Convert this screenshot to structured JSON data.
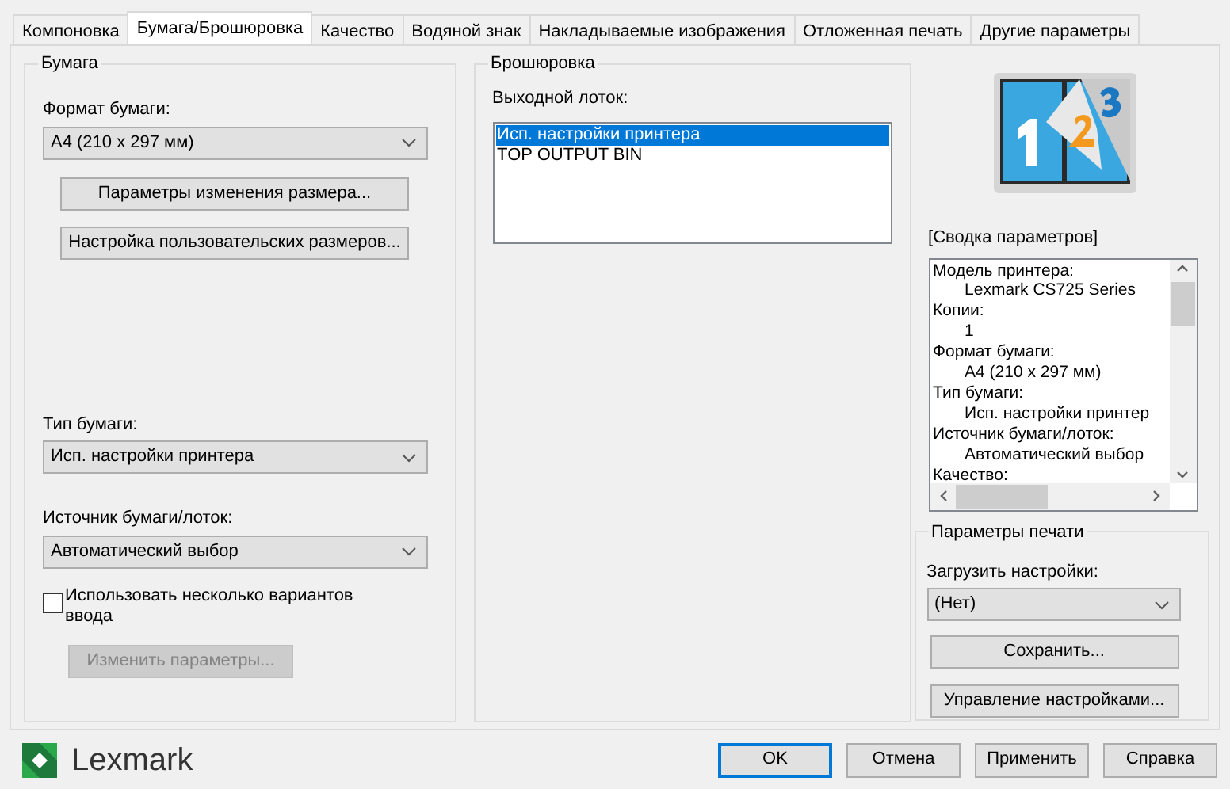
{
  "tabs": [
    {
      "label": "Компоновка",
      "selected": false
    },
    {
      "label": "Бумага/Брошюровка",
      "selected": true
    },
    {
      "label": "Качество",
      "selected": false
    },
    {
      "label": "Водяной знак",
      "selected": false
    },
    {
      "label": "Накладываемые изображения",
      "selected": false
    },
    {
      "label": "Отложенная печать",
      "selected": false
    },
    {
      "label": "Другие параметры",
      "selected": false
    }
  ],
  "paper": {
    "title": "Бумага",
    "size_label": "Формат бумаги:",
    "size_value": "A4 (210 x 297 мм)",
    "resize_button": "Параметры изменения размера...",
    "custom_button": "Настройка пользовательских размеров...",
    "type_label": "Тип бумаги:",
    "type_value": "Исп. настройки принтера",
    "source_label": "Источник бумаги/лоток:",
    "source_value": "Автоматический выбор",
    "multi_input": {
      "label": "Использовать несколько вариантов ввода",
      "checked": false
    },
    "change_button": {
      "label": "Изменить параметры...",
      "disabled": true
    }
  },
  "finishing": {
    "title": "Брошюровка",
    "output_label": "Выходной лоток:",
    "output_items": [
      {
        "label": "Исп. настройки принтера",
        "selected": true
      },
      {
        "label": "TOP OUTPUT BIN",
        "selected": false
      }
    ]
  },
  "summary": {
    "title": "[Сводка параметров]",
    "lines": [
      {
        "kind": "label",
        "text": "Модель принтера:"
      },
      {
        "kind": "value",
        "text": "Lexmark CS725 Series"
      },
      {
        "kind": "label",
        "text": "Копии:"
      },
      {
        "kind": "value",
        "text": "1"
      },
      {
        "kind": "label",
        "text": "Формат бумаги:"
      },
      {
        "kind": "value",
        "text": "A4 (210 x 297 мм)"
      },
      {
        "kind": "label",
        "text": "Тип бумаги:"
      },
      {
        "kind": "value",
        "text": "Исп. настройки принтер"
      },
      {
        "kind": "label",
        "text": "Источник бумаги/лоток:"
      },
      {
        "kind": "value",
        "text": "Автоматический выбор"
      },
      {
        "kind": "label",
        "text": "Качество:"
      }
    ]
  },
  "print_settings": {
    "title": "Параметры печати",
    "load_label": "Загрузить настройки:",
    "load_value": "(Нет)",
    "save_button": "Сохранить...",
    "manage_button": "Управление настройками..."
  },
  "brand": "Lexmark",
  "buttons": [
    {
      "label": "OK",
      "default": true
    },
    {
      "label": "Отмена",
      "default": false
    },
    {
      "label": "Применить",
      "default": false
    },
    {
      "label": "Справка",
      "default": false
    }
  ]
}
